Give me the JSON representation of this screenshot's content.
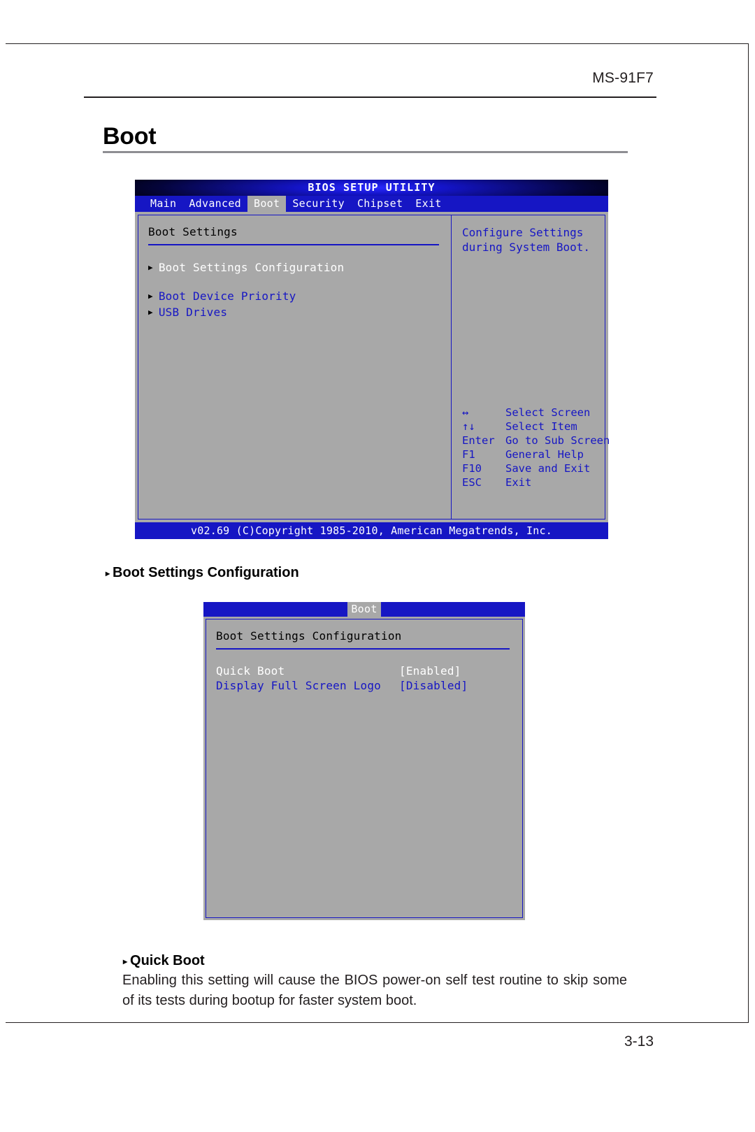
{
  "page": {
    "running_head": "MS-91F7",
    "chapter_title": "Boot",
    "page_number": "3-13"
  },
  "bios_screen_1": {
    "title": "BIOS SETUP UTILITY",
    "menu_items": [
      "Main",
      "Advanced",
      "Boot",
      "Security",
      "Chipset",
      "Exit"
    ],
    "active_menu": "Boot",
    "section_title": "Boot Settings",
    "options": [
      {
        "label": "Boot Settings Configuration",
        "state": "selected"
      },
      {
        "label": "Boot Device Priority",
        "state": "normal"
      },
      {
        "label": "USB Drives",
        "state": "normal"
      }
    ],
    "help_text": "Configure Settings\nduring System Boot.",
    "key_legend": [
      {
        "key": "↔",
        "action": "Select Screen"
      },
      {
        "key": "↑↓",
        "action": "Select Item"
      },
      {
        "key": "Enter",
        "action": "Go to Sub Screen"
      },
      {
        "key": "F1",
        "action": "General Help"
      },
      {
        "key": "F10",
        "action": "Save and Exit"
      },
      {
        "key": "ESC",
        "action": "Exit"
      }
    ],
    "footer": "v02.69 (C)Copyright 1985-2010, American Megatrends, Inc."
  },
  "heading_boot_settings_configuration": "Boot Settings Configuration",
  "bios_screen_2": {
    "menu_label": "Boot",
    "section_title": "Boot Settings Configuration",
    "rows": [
      {
        "label": "Quick Boot",
        "value": "[Enabled]",
        "state": "selected"
      },
      {
        "label": "Display Full Screen Logo",
        "value": "[Disabled]",
        "state": "normal"
      }
    ]
  },
  "heading_quick_boot": "Quick Boot",
  "body_paragraph": "Enabling this setting will cause the BIOS power-on self test routine to skip some of its tests during bootup for faster system boot.",
  "colors": {
    "bios_blue": "#1616c4",
    "bios_gray": "#a8a8a8",
    "rule_gray": "#8e8e93",
    "text_black": "#231f20"
  }
}
